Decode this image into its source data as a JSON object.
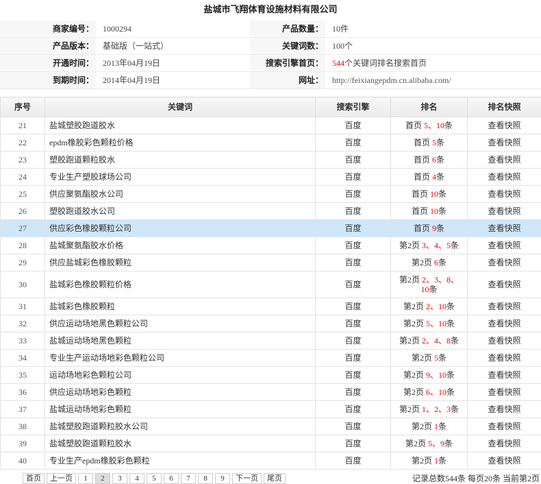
{
  "company_name": "盐城市飞翔体育设施材料有限公司",
  "colors": {
    "highlight_red": "#ff0000",
    "selected_row": "#cfe7f8",
    "current_page": "#dddddd"
  },
  "info": {
    "merchant_id": {
      "label": "商家编号：",
      "value": "1000294"
    },
    "product_count": {
      "label": "产品数量：",
      "value": "10件"
    },
    "product_version": {
      "label": "产品版本：",
      "value": "基础版（一站式）"
    },
    "keyword_count": {
      "label": "关键词数：",
      "value": "100个"
    },
    "open_date": {
      "label": "开通时间：",
      "value": "2013年04月19日"
    },
    "search_home": {
      "label": "搜索引擎首页：",
      "count": "544",
      "value": "个关键词排名搜索首页"
    },
    "expire_date": {
      "label": "到期时间：",
      "value": "2014年04月19日"
    },
    "website": {
      "label": "网址：",
      "value": "http://feixiangepdm.cn.alibaba.com/"
    }
  },
  "table": {
    "headers": [
      "序号",
      "关键词",
      "搜索引擎",
      "排名",
      "排名快照"
    ],
    "highlighted_row": "27",
    "rows": [
      {
        "no": "21",
        "keyword": "盐城塑胶跑道胶水",
        "engine": "百度",
        "page": "首页",
        "positions": "5、10",
        "suffix": "条",
        "snapshot": "查看快照"
      },
      {
        "no": "22",
        "keyword": "epdm橡胶彩色颗粒价格",
        "engine": "百度",
        "page": "首页",
        "positions": "5",
        "suffix": "条",
        "snapshot": "查看快照"
      },
      {
        "no": "23",
        "keyword": "塑胶跑道颗粒胶水",
        "engine": "百度",
        "page": "首页",
        "positions": "6",
        "suffix": "条",
        "snapshot": "查看快照"
      },
      {
        "no": "24",
        "keyword": "专业生产塑胶球场公司",
        "engine": "百度",
        "page": "首页",
        "positions": "4",
        "suffix": "条",
        "snapshot": "查看快照"
      },
      {
        "no": "25",
        "keyword": "供应聚氨酯胶水公司",
        "engine": "百度",
        "page": "首页",
        "positions": "10",
        "suffix": "条",
        "snapshot": "查看快照"
      },
      {
        "no": "26",
        "keyword": "塑胶跑道胶水公司",
        "engine": "百度",
        "page": "首页",
        "positions": "10",
        "suffix": "条",
        "snapshot": "查看快照"
      },
      {
        "no": "27",
        "keyword": "供应彩色橡胶颗粒公司",
        "engine": "百度",
        "page": "首页",
        "positions": "9",
        "suffix": "条",
        "snapshot": "查看快照"
      },
      {
        "no": "28",
        "keyword": "盐城聚氨酯胶水价格",
        "engine": "百度",
        "page": "第2页",
        "positions": "3、4、5",
        "suffix": "条",
        "snapshot": "查看快照"
      },
      {
        "no": "29",
        "keyword": "供应盐城彩色橡胶颗粒",
        "engine": "百度",
        "page": "第2页",
        "positions": "6",
        "suffix": "条",
        "snapshot": "查看快照"
      },
      {
        "no": "30",
        "keyword": "盐城彩色橡胶颗粒价格",
        "engine": "百度",
        "page": "第2页",
        "positions": "2、3、8、10",
        "suffix": "条",
        "snapshot": "查看快照"
      },
      {
        "no": "31",
        "keyword": "盐城彩色橡胶颗粒",
        "engine": "百度",
        "page": "第2页",
        "positions": "2、10",
        "suffix": "条",
        "snapshot": "查看快照"
      },
      {
        "no": "32",
        "keyword": "供应运动场地黑色颗粒公司",
        "engine": "百度",
        "page": "第2页",
        "positions": "5、10",
        "suffix": "条",
        "snapshot": "查看快照"
      },
      {
        "no": "33",
        "keyword": "盐城运动场地黑色颗粒",
        "engine": "百度",
        "page": "第2页",
        "positions": "2、4、8",
        "suffix": "条",
        "snapshot": "查看快照"
      },
      {
        "no": "34",
        "keyword": "专业生产运动场地彩色颗粒公司",
        "engine": "百度",
        "page": "第2页",
        "positions": "5",
        "suffix": "条",
        "snapshot": "查看快照"
      },
      {
        "no": "35",
        "keyword": "运动场地彩色颗粒公司",
        "engine": "百度",
        "page": "第2页",
        "positions": "9、10",
        "suffix": "条",
        "snapshot": "查看快照"
      },
      {
        "no": "36",
        "keyword": "供应运动场地彩色颗粒",
        "engine": "百度",
        "page": "第2页",
        "positions": "6、10",
        "suffix": "条",
        "snapshot": "查看快照"
      },
      {
        "no": "37",
        "keyword": "盐城运动场地彩色颗粒",
        "engine": "百度",
        "page": "第2页",
        "positions": "1、2、3",
        "suffix": "条",
        "snapshot": "查看快照"
      },
      {
        "no": "38",
        "keyword": "盐城塑胶跑道颗粒胶水公司",
        "engine": "百度",
        "page": "第2页",
        "positions": "1",
        "suffix": "条",
        "snapshot": "查看快照"
      },
      {
        "no": "39",
        "keyword": "盐城塑胶跑道颗粒胶水",
        "engine": "百度",
        "page": "第2页",
        "positions": "5、9",
        "suffix": "条",
        "snapshot": "查看快照"
      },
      {
        "no": "40",
        "keyword": "专业生产epdm橡胶彩色颗粒",
        "engine": "百度",
        "page": "第2页",
        "positions": "1",
        "suffix": "条",
        "snapshot": "查看快照"
      }
    ]
  },
  "pagination": {
    "first": "首页",
    "prev": "上一页",
    "pages": [
      "1",
      "2",
      "3",
      "4",
      "5",
      "6",
      "7",
      "8",
      "9"
    ],
    "current": "2",
    "next": "下一页",
    "last": "尾页",
    "summary": "记录总数544条  每页20条  当前第2页"
  }
}
